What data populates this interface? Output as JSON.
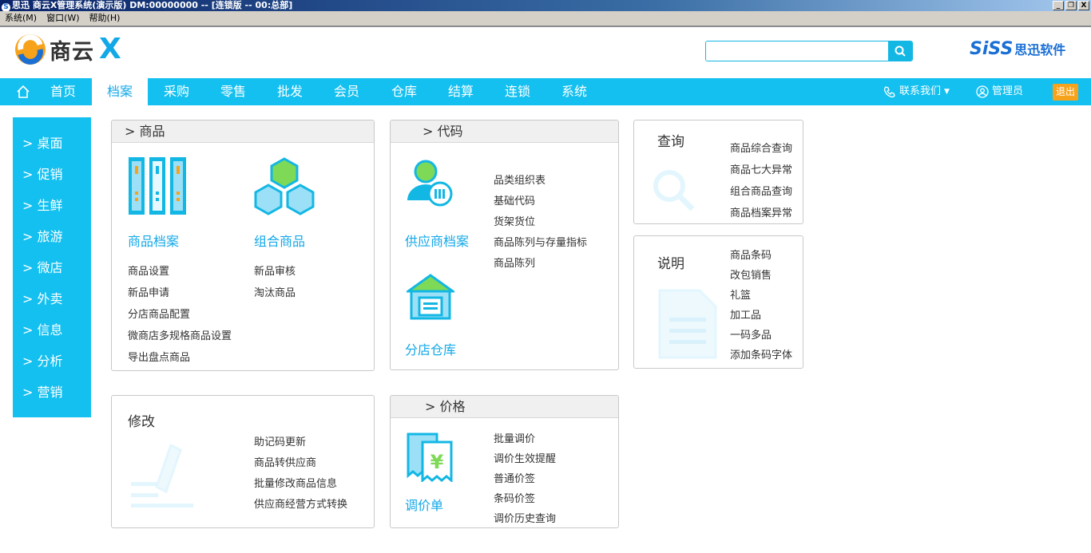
{
  "window": {
    "title": "思迅 商云X管理系统(演示版) DM:00000000 -- [连锁版 -- 00:总部]",
    "buttons": [
      "_",
      "❐",
      "X"
    ]
  },
  "menubar": [
    "系统(M)",
    "窗口(W)",
    "帮助(H)"
  ],
  "logo": {
    "name": "商云",
    "mark": "X"
  },
  "search": {
    "value": "",
    "placeholder": ""
  },
  "brand": {
    "main": "SiSS",
    "sub": "思迅软件"
  },
  "nav": {
    "items": [
      "首页",
      "档案",
      "采购",
      "零售",
      "批发",
      "会员",
      "仓库",
      "结算",
      "连锁",
      "系统"
    ],
    "active": "档案",
    "contact": "联系我们",
    "user": "管理员",
    "logout": "退出"
  },
  "sidebar": [
    "> 桌面",
    "> 促销",
    "> 生鲜",
    "> 旅游",
    "> 微店",
    "> 外卖",
    "> 信息",
    "> 分析",
    "> 营销"
  ],
  "panels": {
    "goods": {
      "header": ">  商品",
      "big": [
        "商品档案",
        "组合商品"
      ],
      "left": [
        "商品设置",
        "新品申请",
        "分店商品配置",
        "微商店多规格商品设置",
        "导出盘点商品"
      ],
      "right": [
        "新品审核",
        "淘汰商品"
      ]
    },
    "code": {
      "header": ">  代码",
      "big": [
        "供应商档案",
        "分店仓库"
      ],
      "links": [
        "品类组织表",
        "基础代码",
        "货架货位",
        "商品陈列与存量指标",
        "商品陈列"
      ]
    },
    "query": {
      "title": "查询",
      "links": [
        "商品综合查询",
        "商品七大异常",
        "组合商品查询",
        "商品档案异常"
      ]
    },
    "explain": {
      "title": "说明",
      "links": [
        "商品条码",
        "改包销售",
        "礼篮",
        "加工品",
        "一码多品",
        "添加条码字体"
      ]
    },
    "modify": {
      "title": "修改",
      "links": [
        "助记码更新",
        "商品转供应商",
        "批量修改商品信息",
        "供应商经营方式转换"
      ]
    },
    "price": {
      "header": ">  价格",
      "big": "调价单",
      "links": [
        "批量调价",
        "调价生效提醒",
        "普通价签",
        "条码价签",
        "调价历史查询"
      ]
    }
  },
  "colors": {
    "accent": "#13c0f0",
    "link": "#13a8e8",
    "logout": "#f7a21b",
    "hex": "#7ed957"
  }
}
